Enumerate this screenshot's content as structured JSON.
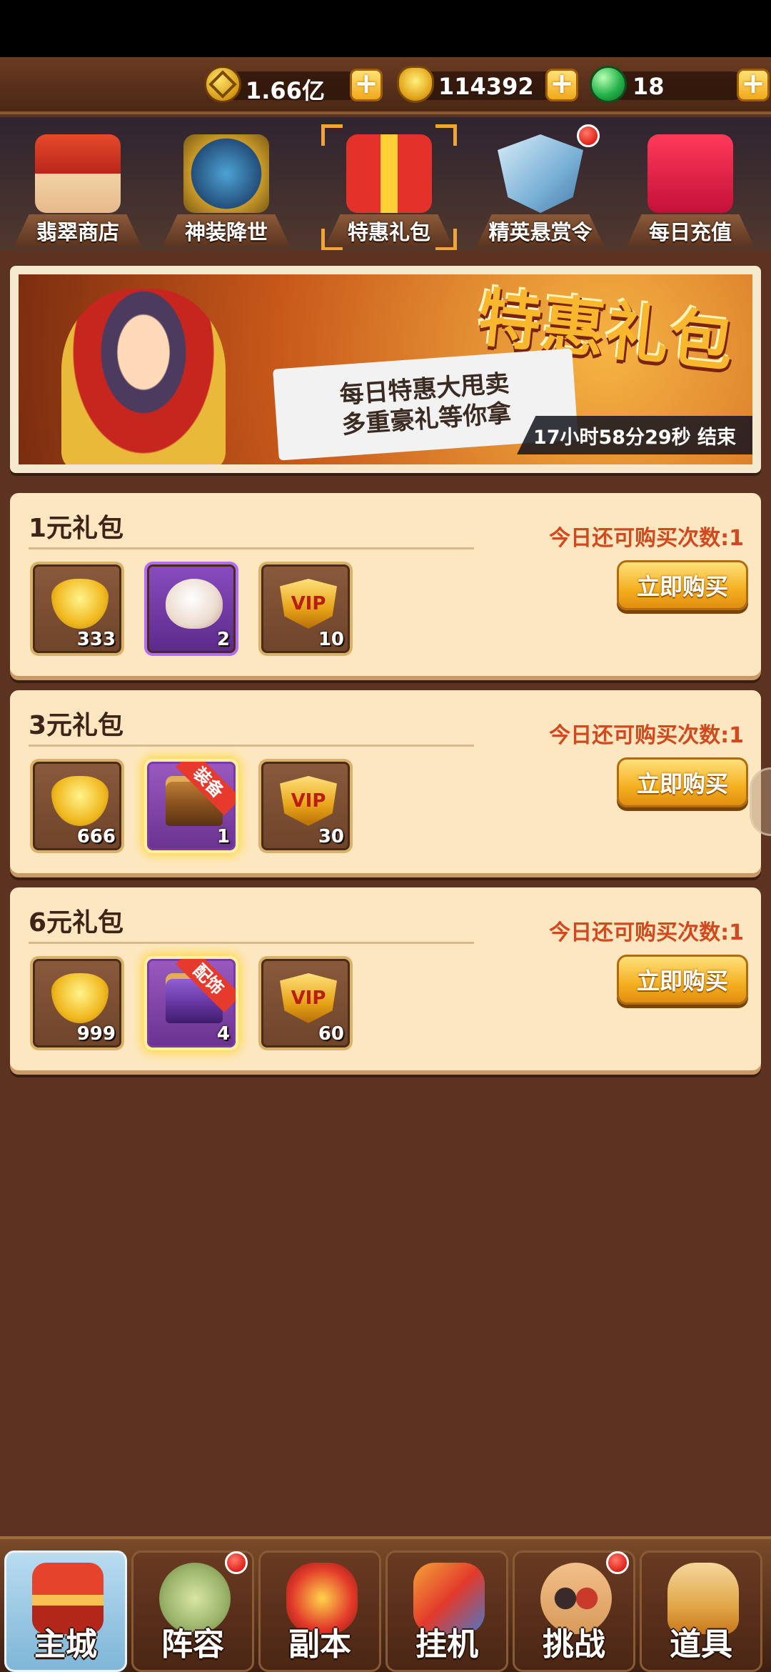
{
  "currencies": [
    {
      "icon": "gold-coin-icon",
      "value": "1.66亿"
    },
    {
      "icon": "gold-ingot-icon",
      "value": "114392"
    },
    {
      "icon": "green-gem-icon",
      "value": "18"
    }
  ],
  "plus_label": "+",
  "shop_tabs": [
    {
      "label": "翡翠商店",
      "icon": "jade-shop-icon",
      "selected": false,
      "badge": false
    },
    {
      "label": "神装降世",
      "icon": "divine-armor-icon",
      "selected": false,
      "badge": false
    },
    {
      "label": "特惠礼包",
      "icon": "gift-box-icon",
      "selected": true,
      "badge": false
    },
    {
      "label": "精英悬赏令",
      "icon": "elite-bounty-shield-icon",
      "selected": false,
      "badge": true
    },
    {
      "label": "每日充值",
      "icon": "daily-recharge-chest-icon",
      "selected": false,
      "badge": false
    }
  ],
  "banner": {
    "title": "特惠礼包",
    "line1": "每日特惠大甩卖",
    "line2": "多重豪礼等你拿",
    "countdown": "17小时58分29秒 结束"
  },
  "packs": [
    {
      "title": "1元礼包",
      "limit": "今日还可购买次数:1",
      "buy_label": "立即购买",
      "items": [
        {
          "icon": "gold-ingot-icon",
          "count": "333"
        },
        {
          "icon": "steamed-bun-icon",
          "count": "2"
        },
        {
          "icon": "vip-badge-icon",
          "count": "10"
        }
      ]
    },
    {
      "title": "3元礼包",
      "limit": "今日还可购买次数:1",
      "buy_label": "立即购买",
      "items": [
        {
          "icon": "gold-ingot-icon",
          "count": "666"
        },
        {
          "icon": "equipment-chest-icon",
          "count": "1",
          "ribbon": "装备"
        },
        {
          "icon": "vip-badge-icon",
          "count": "30"
        }
      ]
    },
    {
      "title": "6元礼包",
      "limit": "今日还可购买次数:1",
      "buy_label": "立即购买",
      "items": [
        {
          "icon": "gold-ingot-icon",
          "count": "999"
        },
        {
          "icon": "accessory-chest-icon",
          "count": "4",
          "ribbon": "配饰"
        },
        {
          "icon": "vip-badge-icon",
          "count": "60"
        }
      ]
    }
  ],
  "bottom_nav": [
    {
      "label": "主城",
      "icon": "main-city-icon",
      "active": true,
      "badge": false
    },
    {
      "label": "阵容",
      "icon": "lineup-icon",
      "active": false,
      "badge": true
    },
    {
      "label": "副本",
      "icon": "dungeon-icon",
      "active": false,
      "badge": false
    },
    {
      "label": "挂机",
      "icon": "idle-icon",
      "active": false,
      "badge": false
    },
    {
      "label": "挑战",
      "icon": "challenge-icon",
      "active": false,
      "badge": true
    },
    {
      "label": "道具",
      "icon": "items-icon",
      "active": false,
      "badge": false
    }
  ]
}
